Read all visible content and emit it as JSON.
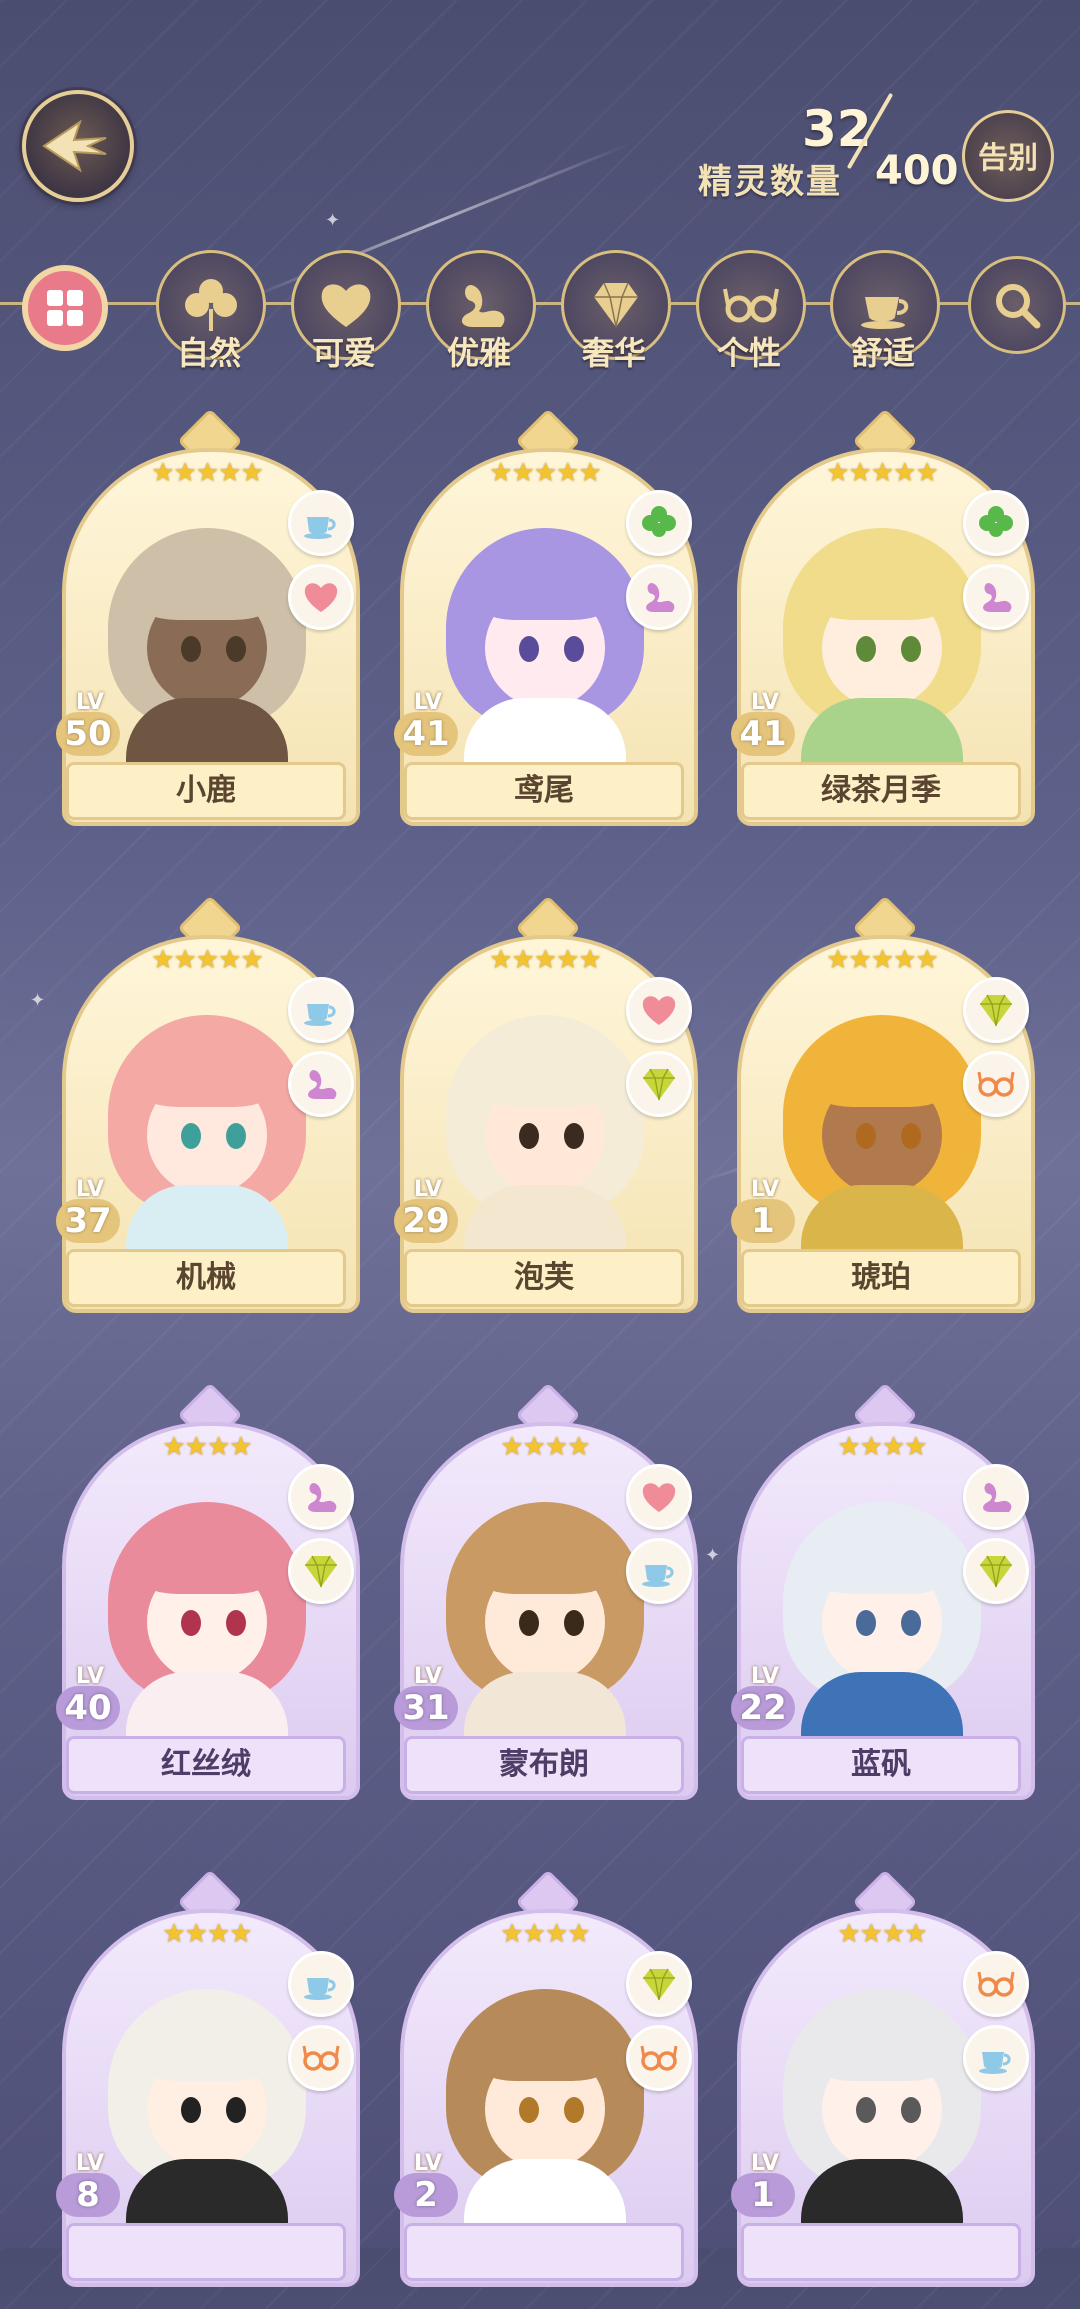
{
  "header": {
    "count_label": "精灵数量",
    "current": "32",
    "max": "400",
    "farewell_label": "告别"
  },
  "filters": [
    {
      "label": "",
      "icon": "category-all-icon"
    },
    {
      "label": "自然",
      "icon": "clover-icon"
    },
    {
      "label": "可爱",
      "icon": "heart-icon"
    },
    {
      "label": "优雅",
      "icon": "swan-icon"
    },
    {
      "label": "奢华",
      "icon": "diamond-icon"
    },
    {
      "label": "个性",
      "icon": "glasses-icon"
    },
    {
      "label": "舒适",
      "icon": "teacup-icon"
    },
    {
      "label": "",
      "icon": "search-icon"
    }
  ],
  "lv_prefix": "LV",
  "cards": [
    {
      "name": "小鹿",
      "level": "50",
      "stars": "★★★★★",
      "tier": "gold",
      "attrs": [
        "teacup-icon",
        "heart-icon"
      ],
      "hair": "#cdbfa8",
      "eye": "#4b3a2a",
      "skin": "#8a6b55",
      "outfit": "#6f5643"
    },
    {
      "name": "鸢尾",
      "level": "41",
      "stars": "★★★★★",
      "tier": "gold",
      "attrs": [
        "clover-icon",
        "swan-icon"
      ],
      "hair": "#a896e2",
      "eye": "#5a4c9a",
      "skin": "#ffeaf0",
      "outfit": "#ffffff"
    },
    {
      "name": "绿茶月季",
      "level": "41",
      "stars": "★★★★★",
      "tier": "gold",
      "attrs": [
        "clover-icon",
        "swan-icon"
      ],
      "hair": "#f0dc8a",
      "eye": "#5f8a3a",
      "skin": "#ffeedd",
      "outfit": "#a9d38a"
    },
    {
      "name": "机械",
      "level": "37",
      "stars": "★★★★★",
      "tier": "gold",
      "attrs": [
        "teacup-icon",
        "swan-icon"
      ],
      "hair": "#f4a9a4",
      "eye": "#3f9f9a",
      "skin": "#ffe9df",
      "outfit": "#d9eef3"
    },
    {
      "name": "泡芙",
      "level": "29",
      "stars": "★★★★★",
      "tier": "gold",
      "attrs": [
        "heart-icon",
        "diamond-icon"
      ],
      "hair": "#f5ecd8",
      "eye": "#3a2a20",
      "skin": "#ffe8d8",
      "outfit": "#f4e7cf"
    },
    {
      "name": "琥珀",
      "level": "1",
      "stars": "★★★★★",
      "tier": "gold",
      "attrs": [
        "diamond-icon",
        "glasses-icon"
      ],
      "hair": "#f1b43a",
      "eye": "#b06a20",
      "skin": "#b07a4e",
      "outfit": "#d9b54a"
    },
    {
      "name": "红丝绒",
      "level": "40",
      "stars": "★★★★",
      "tier": "purple",
      "attrs": [
        "swan-icon",
        "diamond-icon"
      ],
      "hair": "#ea8b9c",
      "eye": "#b0344e",
      "skin": "#fff0ea",
      "outfit": "#fbeef0"
    },
    {
      "name": "蒙布朗",
      "level": "31",
      "stars": "★★★★",
      "tier": "purple",
      "attrs": [
        "heart-icon",
        "teacup-icon"
      ],
      "hair": "#c99a64",
      "eye": "#3a2a1a",
      "skin": "#ffe9d8",
      "outfit": "#f2e6d6"
    },
    {
      "name": "蓝矾",
      "level": "22",
      "stars": "★★★★",
      "tier": "purple",
      "attrs": [
        "swan-icon",
        "diamond-icon"
      ],
      "hair": "#e7edf3",
      "eye": "#4a6a9a",
      "skin": "#fff1ea",
      "outfit": "#3f73b8"
    },
    {
      "name": "",
      "level": "8",
      "stars": "★★★★",
      "tier": "purple",
      "attrs": [
        "teacup-icon",
        "glasses-icon"
      ],
      "hair": "#f1efe8",
      "eye": "#222222",
      "skin": "#ffeee2",
      "outfit": "#2a2a2a"
    },
    {
      "name": "",
      "level": "2",
      "stars": "★★★★",
      "tier": "purple",
      "attrs": [
        "diamond-icon",
        "glasses-icon"
      ],
      "hair": "#b78a5a",
      "eye": "#b07a2a",
      "skin": "#ffe9d8",
      "outfit": "#ffffff"
    },
    {
      "name": "",
      "level": "1",
      "stars": "★★★★",
      "tier": "purple",
      "attrs": [
        "glasses-icon",
        "teacup-icon"
      ],
      "hair": "#e9e9ec",
      "eye": "#5a5a5a",
      "skin": "#fff0ea",
      "outfit": "#2a2a2a"
    }
  ]
}
